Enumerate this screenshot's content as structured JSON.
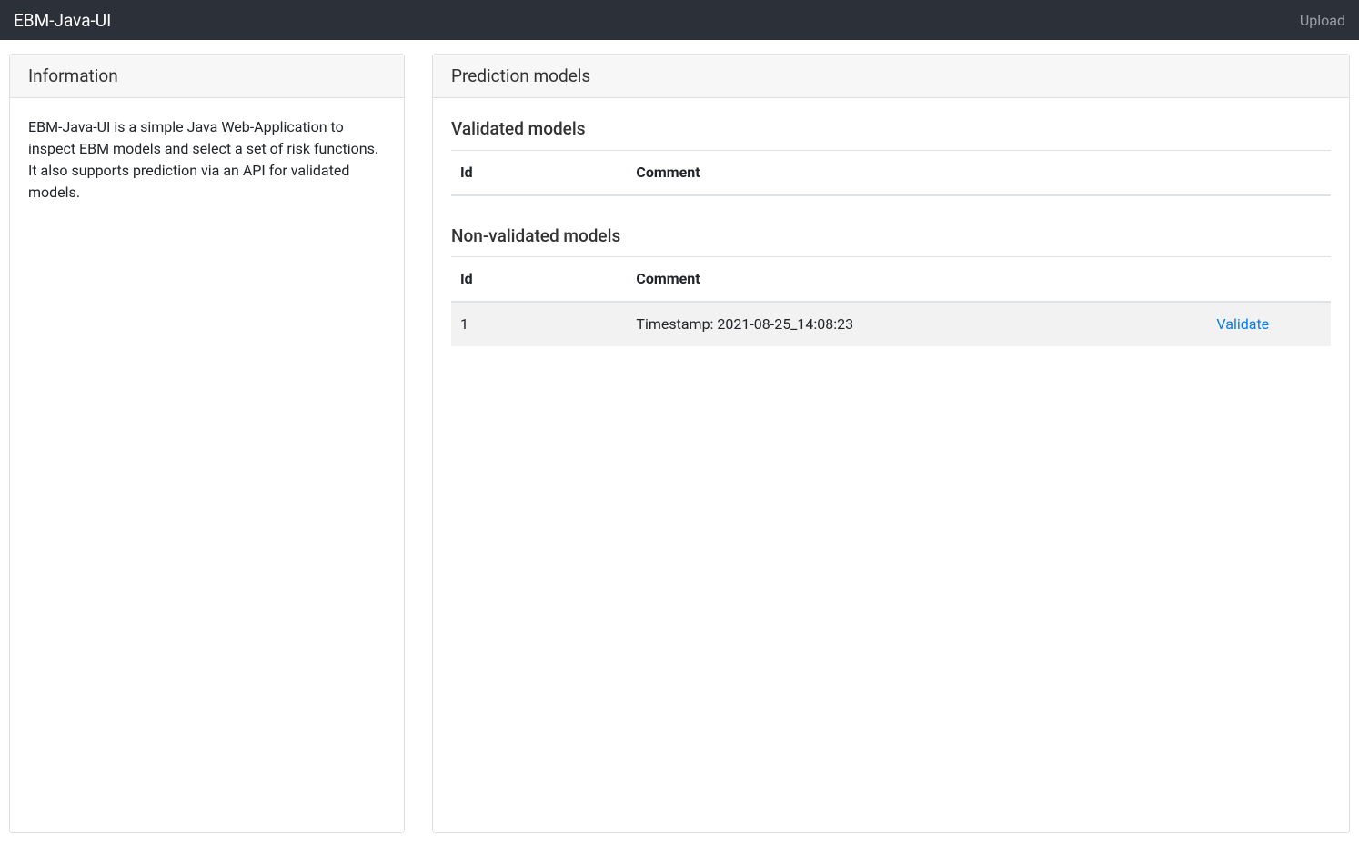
{
  "navbar": {
    "brand": "EBM-Java-UI",
    "upload": "Upload"
  },
  "info": {
    "title": "Information",
    "body": "EBM-Java-UI is a simple Java Web-Application to inspect EBM models and select a set of risk functions. It also supports prediction via an API for validated models."
  },
  "models": {
    "title": "Prediction models",
    "validated": {
      "title": "Validated models",
      "headers": {
        "id": "Id",
        "comment": "Comment"
      },
      "rows": []
    },
    "nonvalidated": {
      "title": "Non-validated models",
      "headers": {
        "id": "Id",
        "comment": "Comment"
      },
      "rows": [
        {
          "id": "1",
          "comment": "Timestamp: 2021-08-25_14:08:23",
          "action": "Validate"
        }
      ]
    }
  }
}
